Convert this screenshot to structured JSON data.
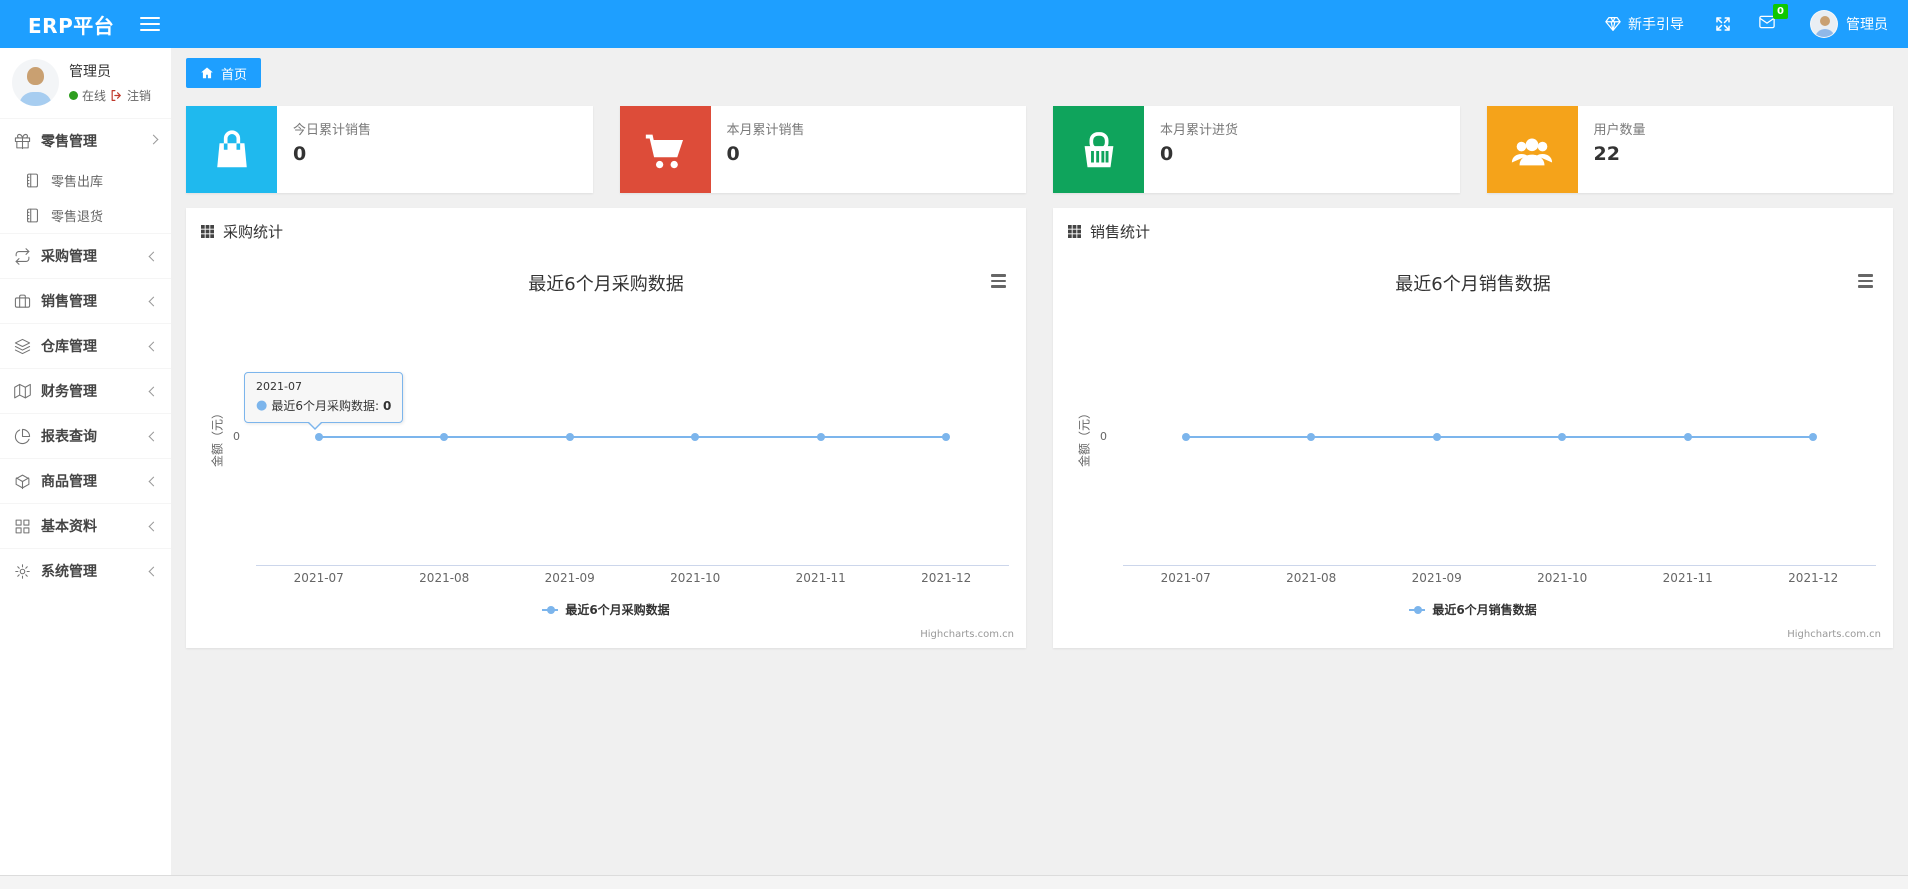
{
  "navbar": {
    "brand": "ERP平台",
    "guide_label": "新手引导",
    "mail_badge": "0",
    "username": "管理员",
    "accent_color": "#1E9FFF",
    "badge_color": "#0FC700"
  },
  "sidebar": {
    "user": {
      "name": "管理员",
      "status": "在线",
      "logout": "注销"
    },
    "items": [
      {
        "label": "零售管理",
        "icon": "gift-icon",
        "state": "expanded"
      },
      {
        "label": "零售出库",
        "icon": "journal-icon"
      },
      {
        "label": "零售退货",
        "icon": "journal-icon"
      },
      {
        "label": "采购管理",
        "icon": "repeat-icon",
        "state": "collapsed"
      },
      {
        "label": "销售管理",
        "icon": "briefcase-icon",
        "state": "collapsed"
      },
      {
        "label": "仓库管理",
        "icon": "layers-icon",
        "state": "collapsed"
      },
      {
        "label": "财务管理",
        "icon": "map-icon",
        "state": "collapsed"
      },
      {
        "label": "报表查询",
        "icon": "pie-chart-icon",
        "state": "collapsed"
      },
      {
        "label": "商品管理",
        "icon": "package-icon",
        "state": "collapsed"
      },
      {
        "label": "基本资料",
        "icon": "grid-icon",
        "state": "collapsed"
      },
      {
        "label": "系统管理",
        "icon": "gear-icon",
        "state": "collapsed"
      }
    ]
  },
  "tabs": {
    "home": "首页"
  },
  "cards": [
    {
      "label": "今日累计销售",
      "value": "0",
      "color": "#1FB9EE",
      "icon": "shopping-bag-icon"
    },
    {
      "label": "本月累计销售",
      "value": "0",
      "color": "#DD4C39",
      "icon": "cart-icon"
    },
    {
      "label": "本月累计进货",
      "value": "0",
      "color": "#0FA45C",
      "icon": "basket-icon"
    },
    {
      "label": "用户数量",
      "value": "22",
      "color": "#F5A31A",
      "icon": "users-icon"
    }
  ],
  "panels": [
    {
      "header": "采购统计"
    },
    {
      "header": "销售统计"
    }
  ],
  "tooltip": {
    "header": "2021-07",
    "label": "最近6个月采购数据:",
    "value": "0"
  },
  "chart_data": [
    {
      "type": "line",
      "title": "最近6个月采购数据",
      "categories": [
        "2021-07",
        "2021-08",
        "2021-09",
        "2021-10",
        "2021-11",
        "2021-12"
      ],
      "series": [
        {
          "name": "最近6个月采购数据",
          "values": [
            0,
            0,
            0,
            0,
            0,
            0
          ]
        }
      ],
      "xlabel": "",
      "ylabel": "金额（元）",
      "ytick": "0",
      "ylim": [
        0,
        0
      ],
      "grid": false,
      "legend_position": "bottom",
      "line_color": "#7cb5ec",
      "credits": "Highcharts.com.cn"
    },
    {
      "type": "line",
      "title": "最近6个月销售数据",
      "categories": [
        "2021-07",
        "2021-08",
        "2021-09",
        "2021-10",
        "2021-11",
        "2021-12"
      ],
      "series": [
        {
          "name": "最近6个月销售数据",
          "values": [
            0,
            0,
            0,
            0,
            0,
            0
          ]
        }
      ],
      "xlabel": "",
      "ylabel": "金额（元）",
      "ytick": "0",
      "ylim": [
        0,
        0
      ],
      "grid": false,
      "legend_position": "bottom",
      "line_color": "#7cb5ec",
      "credits": "Highcharts.com.cn"
    }
  ]
}
